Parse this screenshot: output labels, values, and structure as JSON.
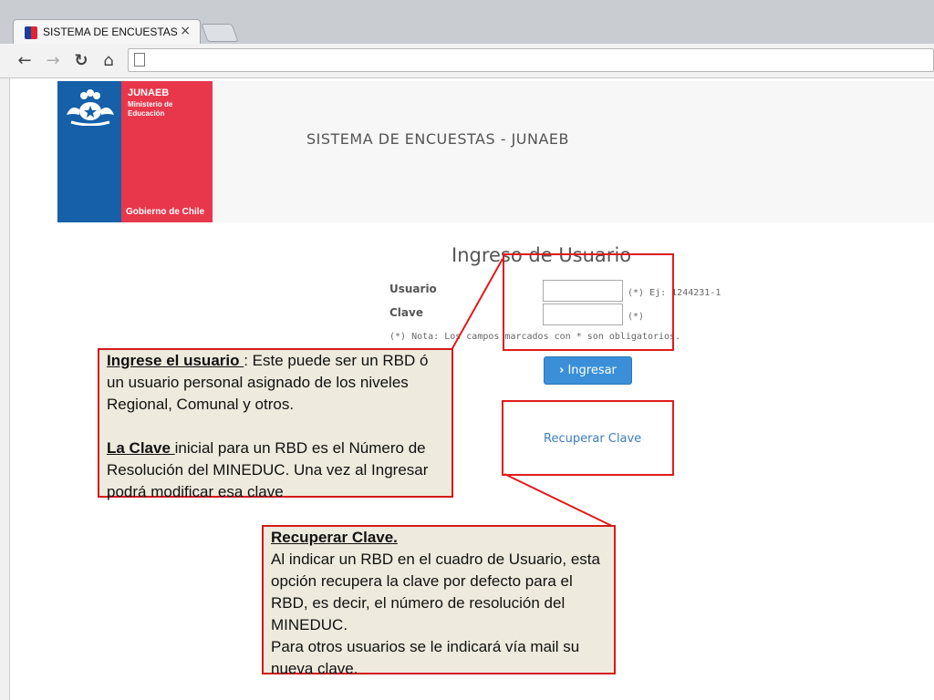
{
  "browser": {
    "tab_title": "SISTEMA DE ENCUESTAS - JUNAEB",
    "tab_close": "×",
    "back": "←",
    "forward": "→",
    "reload": "↻",
    "home": "⌂",
    "address": ""
  },
  "header": {
    "org_name": "JUNAEB",
    "org_sub": "Ministerio de Educación",
    "gov_label": "Gobierno de Chile",
    "site_title": "SISTEMA DE ENCUESTAS - JUNAEB",
    "colors": {
      "blue": "#1560a8",
      "red": "#e8374b"
    }
  },
  "login": {
    "title": "Ingreso de Usuario",
    "user_label": "Usuario",
    "user_hint": "(*) Ej: 1244231-1",
    "user_value": "",
    "pass_label": "Clave",
    "pass_hint": "(*)",
    "pass_value": "",
    "note": "(*) Nota: Los campos marcados con * son obligatorios.",
    "submit_label": "Ingresar",
    "recover_label": "Recuperar Clave"
  },
  "annotations": {
    "left": {
      "p1_head": "Ingrese el usuario ",
      "p1_body": ": Este puede ser un RBD ó un usuario personal asignado de los niveles Regional, Comunal y otros.",
      "p2_head": "La Clave ",
      "p2_body": "inicial para un RBD es el Número de Resolución del MINEDUC. Una vez al Ingresar podrá modificar esa clave"
    },
    "bottom": {
      "head": "Recuperar Clave.",
      "body1": "Al indicar un RBD en el cuadro de Usuario, esta opción recupera la clave por defecto para el RBD, es decir,  el número de resolución del MINEDUC.",
      "body2": "Para otros usuarios se le indicará vía mail su nueva clave."
    },
    "color": "#e01b1b"
  }
}
